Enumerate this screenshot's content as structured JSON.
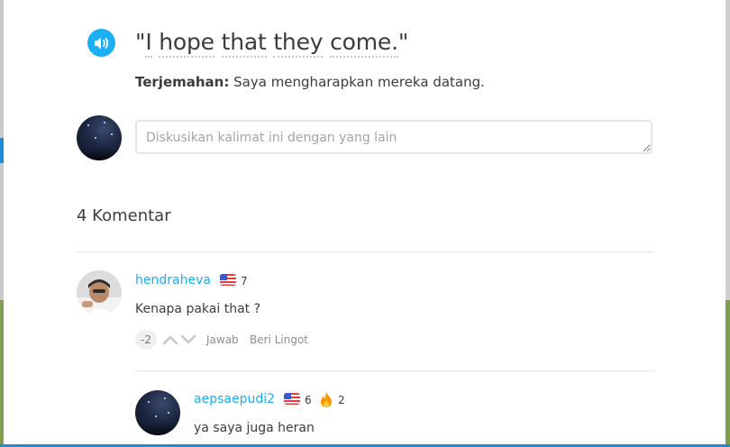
{
  "sentence": {
    "open_quote": "\"",
    "words": [
      "I",
      "hope",
      "that",
      "they",
      "come."
    ],
    "close_quote": "\"",
    "audio_icon": "speaker-icon"
  },
  "translation": {
    "label": "Terjemahan:",
    "text": "Saya mengharapkan mereka datang."
  },
  "discussion": {
    "placeholder": "Diskusikan kalimat ini dengan yang lain"
  },
  "comments_header": "4 Komentar",
  "comments": [
    {
      "username": "hendraheva",
      "flag_icon": "us-flag-icon",
      "level": "7",
      "text": "Kenapa pakai that ?",
      "votes": "-2",
      "reply_label": "Jawab",
      "lingot_label": "Beri Lingot"
    },
    {
      "username": "aepsaepudi2",
      "flag_icon": "us-flag-icon",
      "level": "6",
      "streak_icon": "flame-icon",
      "streak": "2",
      "text": "ya saya juga heran"
    }
  ],
  "colors": {
    "accent": "#1caff6",
    "text": "#3c3c3c",
    "muted": "#8c8c8c",
    "divider": "#e5e5e5",
    "flame": "#ff9600"
  }
}
